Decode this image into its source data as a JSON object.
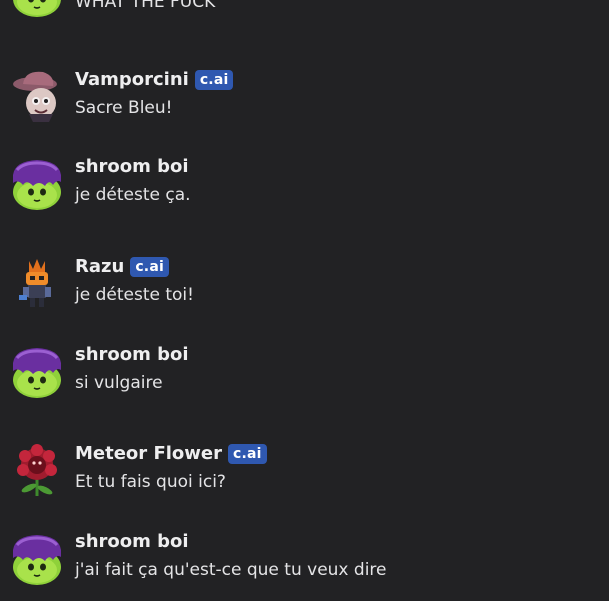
{
  "messages": [
    {
      "author": "",
      "badge": "",
      "text": "WHAT THE FUCK",
      "avatar": "shroom-avatar"
    },
    {
      "author": "Vamporcini",
      "badge": "c.ai",
      "text": "Sacre Bleu!",
      "avatar": "hat-avatar"
    },
    {
      "author": "shroom boi",
      "badge": "",
      "text": "je déteste ça.",
      "avatar": "shroom-avatar"
    },
    {
      "author": "Razu",
      "badge": "c.ai",
      "text": "je déteste toi!",
      "avatar": "robot-avatar"
    },
    {
      "author": "shroom boi",
      "badge": "",
      "text": "si vulgaire",
      "avatar": "shroom-avatar"
    },
    {
      "author": "Meteor Flower",
      "badge": "c.ai",
      "text": "Et tu fais quoi ici?",
      "avatar": "flower-avatar"
    },
    {
      "author": "shroom boi",
      "badge": "",
      "text": "j'ai fait ça qu'est-ce que tu veux dire",
      "avatar": "shroom-avatar"
    }
  ],
  "colors": {
    "background": "#222224",
    "badge": "#2f58b0",
    "text": "#e4e4e6"
  }
}
